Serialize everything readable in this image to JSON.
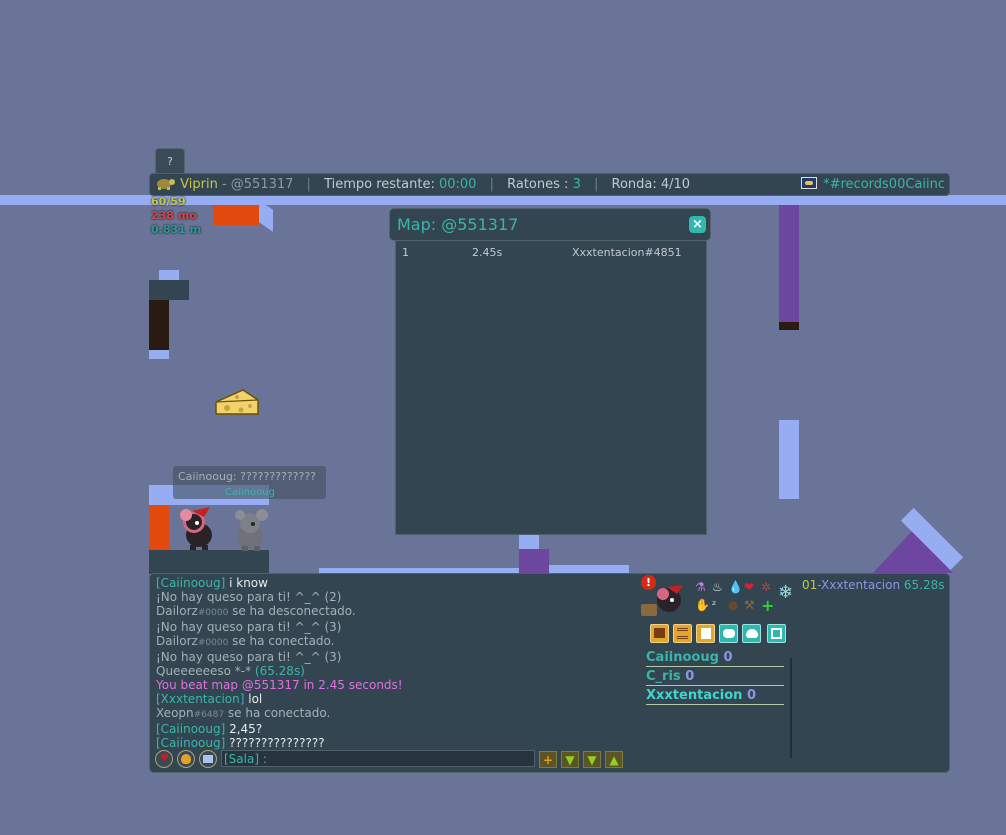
{
  "help_tab": {
    "label": "?"
  },
  "top_bar": {
    "player": "Viprin",
    "map_code": "- @551317",
    "time_label": "Tiempo restante:",
    "time_value": "00:00",
    "mice_label": "Ratones :",
    "mice_value": "3",
    "round_label": "Ronda: 4/10",
    "room": "*#records00Caiinc"
  },
  "stats": {
    "line1": "60/59",
    "line2": "238 mo",
    "line3": "0.831 m"
  },
  "map_leaderboard": {
    "title": "Map: @551317",
    "close_glyph": "×",
    "rows": [
      {
        "rank": "1",
        "time": "2.45s",
        "player": "Xxxtentacion#4851"
      }
    ]
  },
  "bubble": {
    "text": "Caiinooug: ?????????????",
    "name": "Caiinooug"
  },
  "chat": {
    "lines": [
      {
        "parts": [
          {
            "t": "[Caiinooug] ",
            "c": "cyanu"
          },
          {
            "t": "i know",
            "c": "white"
          }
        ]
      },
      {
        "parts": [
          {
            "t": "¡No hay queso para ti! ^_^ (2)",
            "c": "grey"
          }
        ]
      },
      {
        "parts": [
          {
            "t": "Dailorz",
            "c": "grey"
          },
          {
            "t": "#0000",
            "c": "tag"
          },
          {
            "t": " se ha desconectado.",
            "c": "grey"
          }
        ]
      },
      {
        "parts": [
          {
            "t": "¡No hay queso para ti! ^_^ (3)",
            "c": "grey"
          }
        ]
      },
      {
        "parts": [
          {
            "t": "Dailorz",
            "c": "grey"
          },
          {
            "t": "#0000",
            "c": "tag"
          },
          {
            "t": " se ha conectado.",
            "c": "grey"
          }
        ]
      },
      {
        "parts": [
          {
            "t": "¡No hay queso para ti! ^_^ (3)",
            "c": "grey"
          }
        ]
      },
      {
        "parts": [
          {
            "t": "Queeeeeeso *-* ",
            "c": "grey"
          },
          {
            "t": "(65.28s)",
            "c": "cyanu"
          }
        ]
      },
      {
        "parts": [
          {
            "t": "You beat map @551317 in 2.45 seconds!",
            "c": "pink"
          }
        ]
      },
      {
        "parts": [
          {
            "t": "[Xxxtentacion] ",
            "c": "cyanu"
          },
          {
            "t": "lol",
            "c": "white"
          }
        ]
      },
      {
        "parts": [
          {
            "t": "Xeopn",
            "c": "grey"
          },
          {
            "t": "#6487",
            "c": "tag"
          },
          {
            "t": " se ha conectado.",
            "c": "grey"
          }
        ]
      },
      {
        "parts": [
          {
            "t": "[Caiinooug] ",
            "c": "cyanu"
          },
          {
            "t": "2,45?",
            "c": "white"
          }
        ]
      },
      {
        "parts": [
          {
            "t": "[Caiinooug] ",
            "c": "cyanu"
          },
          {
            "t": "???????????????",
            "c": "white"
          }
        ]
      }
    ],
    "input_placeholder": "[Sala] :"
  },
  "score_line": {
    "rank": "01",
    "player": "-Xxxtentacion",
    "time": "65.28s"
  },
  "players": [
    {
      "name": "Caiinooug",
      "score": "0"
    },
    {
      "name": "C_ris",
      "score": "0"
    },
    {
      "name": "Xxxtentacion",
      "score": "0"
    }
  ],
  "colors": {
    "background": "#6a7398",
    "panel": "#324550",
    "accent_cyan": "#3cb5a9",
    "platform_blue": "#97adf3",
    "orange": "#e24a0d",
    "purple": "#6d46a0"
  }
}
